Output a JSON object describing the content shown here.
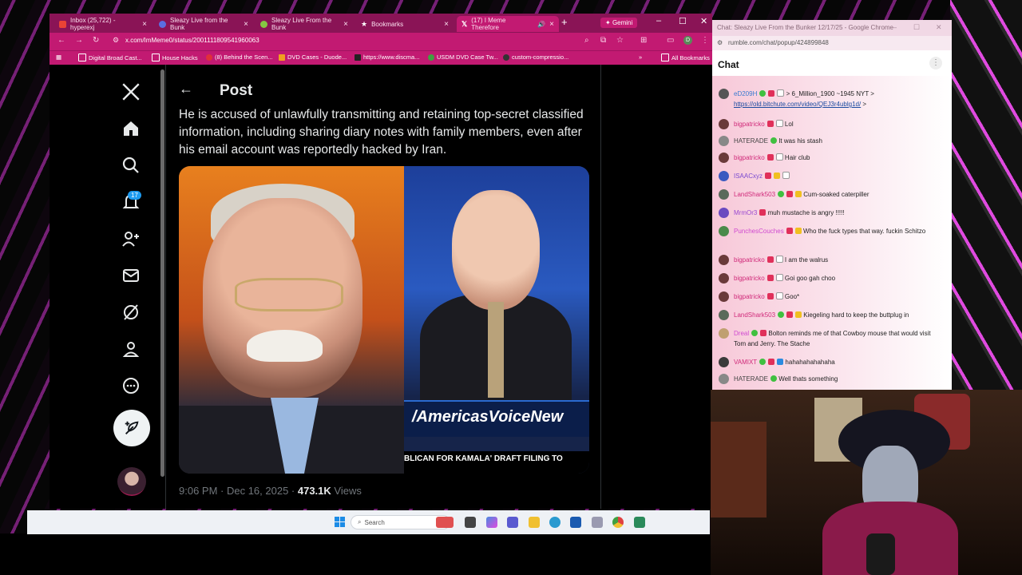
{
  "browser": {
    "tabs": [
      {
        "title": "Inbox (25,722) - hyperexj",
        "icon_color": "#ea4335"
      },
      {
        "title": "Sleazy Live from the Bunk",
        "icon_color": "#5b6ee1"
      },
      {
        "title": "Sleazy Live From the Bunk",
        "icon_color": "#85c742"
      },
      {
        "title": "Bookmarks",
        "icon_color": "#ffffff"
      },
      {
        "title": "(17) I Meme Therefore",
        "icon_color": "#000000"
      }
    ],
    "gemini_label": "Gemini",
    "url": "x.com/ImMeme0/status/2001111809541960063",
    "bookmarks": [
      "Digital Broad Cast...",
      "House Hacks",
      "(8) Behind the Scen...",
      "DVD Cases - Duode...",
      "https://www.discma...",
      "USDM DVD Case Tw...",
      "custom-compressio..."
    ],
    "all_bookmarks_label": "All Bookmarks"
  },
  "x": {
    "notification_count": "17",
    "header_title": "Post",
    "post_text": "He is accused of unlawfully transmitting and retaining top-secret classified information, including sharing diary notes with family members, even after his email account was reportedly hacked by Iran.",
    "media_banner": "/AmericasVoiceNew",
    "media_ticker": "BLICAN FOR KAMALA' DRAFT FILING TO",
    "timestamp": "9:06 PM · Dec 16, 2025 · ",
    "views_count": "473.1K",
    "views_label": " Views"
  },
  "taskbar": {
    "search_placeholder": "Search"
  },
  "chat": {
    "window_title": "Chat: Sleazy Live From the Bunker 12/17/25 - Google Chrome",
    "url": "rumble.com/chat/popup/424899848",
    "header": "Chat",
    "messages": [
      {
        "user": "eD209H",
        "user_color": "#3a7ad0",
        "prefix": " > 6_Million_1900 ~1945 NYT > ",
        "text": "https://old.bitchute.com/video/QEJ3r4ublg1d/",
        "suffix": " >",
        "avatar": "#555"
      },
      {
        "user": "bigpatricko",
        "user_color": "#d02a7a",
        "text": "Lol",
        "avatar": "#6a3a3a"
      },
      {
        "user": "HATERADE",
        "user_color": "#444",
        "text": "It was his stash",
        "avatar": "#888"
      },
      {
        "user": "bigpatricko",
        "user_color": "#d02a7a",
        "text": "Hair club",
        "avatar": "#6a3a3a"
      },
      {
        "user": "ISAACxyz",
        "user_color": "#7a4ad0",
        "text": "",
        "avatar": "#3a5ac0"
      },
      {
        "user": "LandShark503",
        "user_color": "#d02a7a",
        "text": "Cum-soaked caterpiller",
        "avatar": "#5a6a5a"
      },
      {
        "user": "MrmOr3",
        "user_color": "#9a4ad0",
        "text": "muh mustache is angry !!!!!",
        "avatar": "#6a4ac0"
      },
      {
        "user": "PunchesCouches",
        "user_color": "#d04ad0",
        "text": "Who the fuck types that way. fuckin Schitzo",
        "avatar": "#4a8a4a"
      },
      {
        "user": "bigpatricko",
        "user_color": "#d02a7a",
        "text": "I am the walrus",
        "avatar": "#6a3a3a"
      },
      {
        "user": "bigpatricko",
        "user_color": "#d02a7a",
        "text": "Goi goo gah choo",
        "avatar": "#6a3a3a"
      },
      {
        "user": "bigpatricko",
        "user_color": "#d02a7a",
        "text": "Goo*",
        "avatar": "#6a3a3a"
      },
      {
        "user": "LandShark503",
        "user_color": "#d02a7a",
        "text": "Kiegeling hard to keep the buttplug in",
        "avatar": "#5a6a5a"
      },
      {
        "user": "Dreal",
        "user_color": "#d04ad0",
        "text": "Bolton reminds me of that Cowboy mouse that would visit Tom and Jerry. The Stache",
        "avatar": "#c0a070"
      },
      {
        "user": "VAMIXT",
        "user_color": "#d02a7a",
        "text": "hahahahahahaha",
        "avatar": "#3a3a3a"
      },
      {
        "user": "HATERADE",
        "user_color": "#444",
        "text": "Well thats something",
        "avatar": "#888"
      }
    ]
  }
}
